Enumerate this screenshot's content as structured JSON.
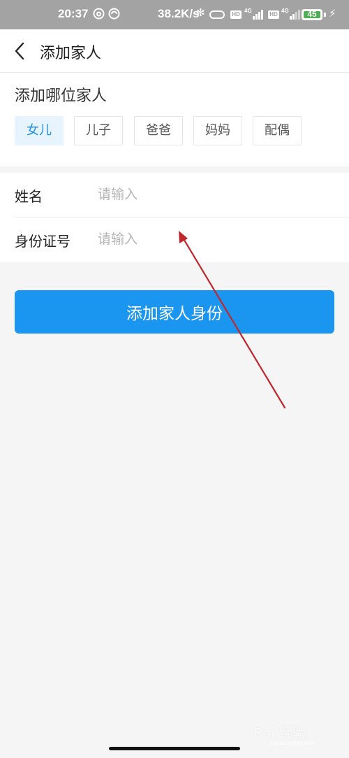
{
  "status_bar": {
    "time": "20:37",
    "network_speed": "38.2K/s",
    "bluetooth_glyph": "✻",
    "hd_label": "HD",
    "signal_label": "4G",
    "battery_level": "45",
    "charging_glyph": "⚡",
    "icons": [
      "netease-music-icon",
      "app-notification-icon",
      "bluetooth-icon",
      "vpn-pill-icon",
      "hd-icon",
      "signal-icon",
      "battery-icon",
      "charging-icon"
    ]
  },
  "nav": {
    "back_icon": "chevron-left-icon",
    "title": "添加家人"
  },
  "relation_section": {
    "heading": "添加哪位家人",
    "options": [
      {
        "label": "女儿",
        "selected": true
      },
      {
        "label": "儿子",
        "selected": false
      },
      {
        "label": "爸爸",
        "selected": false
      },
      {
        "label": "妈妈",
        "selected": false
      },
      {
        "label": "配偶",
        "selected": false
      }
    ]
  },
  "form": {
    "name": {
      "label": "姓名",
      "value": "",
      "placeholder": "请输入"
    },
    "id_number": {
      "label": "身份证号",
      "value": "",
      "placeholder": "请输入"
    }
  },
  "submit": {
    "label": "添加家人身份"
  },
  "watermark": {
    "text": "Bai 经验",
    "sub": "jingyan.baidu.com"
  },
  "colors": {
    "accent": "#1a96f0",
    "selected_chip_bg": "#e7f4fd",
    "selected_chip_text": "#1b8fe6",
    "annotation_arrow": "#c0272d",
    "status_bar_bg": "#a3a3a3",
    "page_bg": "#f5f5f6"
  }
}
